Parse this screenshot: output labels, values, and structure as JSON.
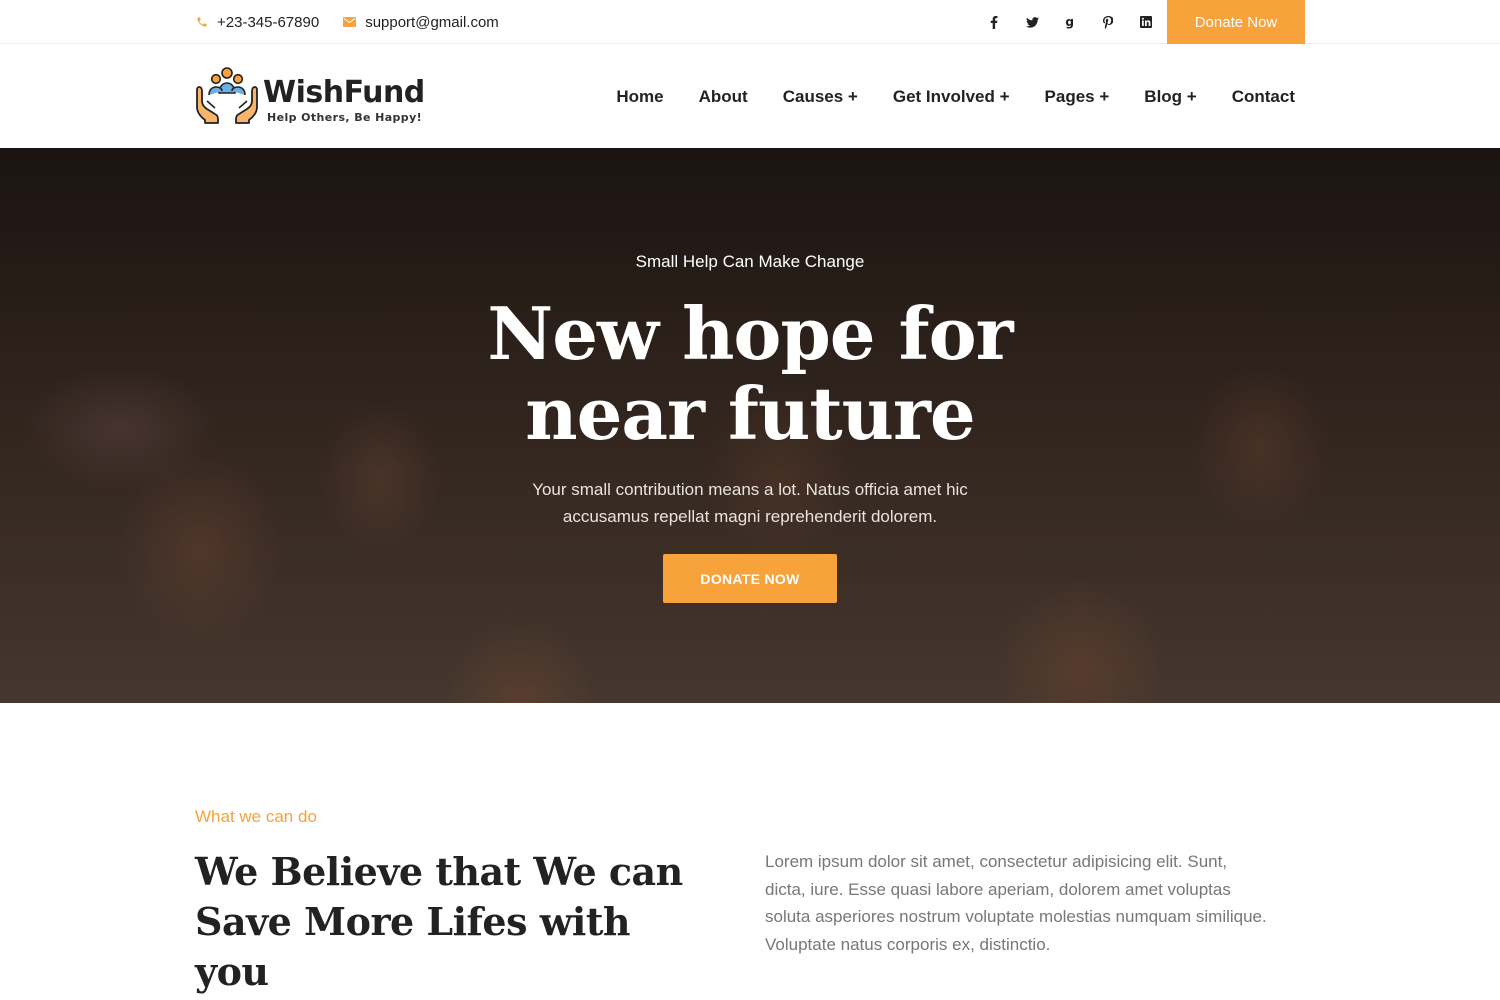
{
  "topbar": {
    "phone": "+23-345-67890",
    "email": "support@gmail.com",
    "social": [
      "facebook-icon",
      "twitter-icon",
      "google-icon",
      "pinterest-icon",
      "linkedin-icon"
    ],
    "donate_label": "Donate Now"
  },
  "header": {
    "brand": "WishFund",
    "tagline": "Help Others, Be Happy!",
    "nav": {
      "home": "Home",
      "about": "About",
      "causes": "Causes +",
      "get_involved": "Get Involved +",
      "pages": "Pages +",
      "blog": "Blog +",
      "contact": "Contact"
    }
  },
  "hero": {
    "kicker": "Small Help Can Make Change",
    "title_line1": "New hope for",
    "title_line2": "near future",
    "description": "Your small contribution means a lot. Natus officia amet hic accusamus repellat magni reprehenderit dolorem.",
    "cta": "DONATE NOW"
  },
  "about": {
    "eyebrow": "What we can do",
    "title_line1": "We Believe that We can",
    "title_line2": "Save More Lifes with you",
    "body": "Lorem ipsum dolor sit amet, consectetur adipisicing elit. Sunt, dicta, iure. Esse quasi labore aperiam, dolorem amet voluptas soluta asperiores nostrum voluptate molestias numquam similique. Voluptate natus corporis ex, distinctio."
  },
  "colors": {
    "accent": "#f7a23a",
    "text_dark": "#222222",
    "text_muted": "#777777"
  }
}
